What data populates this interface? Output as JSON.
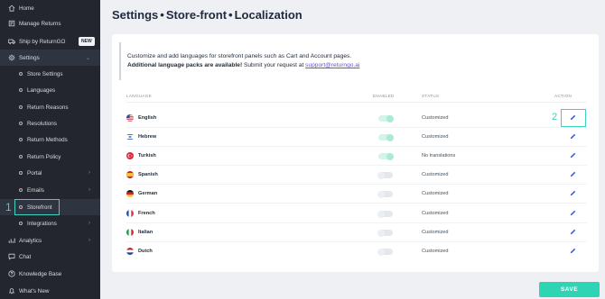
{
  "sidebar": {
    "items": [
      {
        "label": "Home",
        "icon": "home-icon"
      },
      {
        "label": "Manage Returns",
        "icon": "returns-icon"
      },
      {
        "label": "Ship by ReturnGO",
        "icon": "truck-icon",
        "badge": "NEW"
      },
      {
        "label": "Settings",
        "icon": "gear-icon"
      }
    ],
    "settings_sub": [
      "Store Settings",
      "Languages",
      "Return Reasons",
      "Resolutions",
      "Return Methods",
      "Return Policy",
      "Portal",
      "Emails",
      "Storefront",
      "Integrations"
    ],
    "bottom_items": [
      {
        "label": "Analytics",
        "icon": "chart-icon"
      },
      {
        "label": "Chat",
        "icon": "chat-icon"
      },
      {
        "label": "Knowledge Base",
        "icon": "help-icon"
      },
      {
        "label": "What's New",
        "icon": "bell-icon"
      }
    ]
  },
  "annotations": {
    "step1": "1",
    "step2": "2",
    "accent": "#3ed2c3"
  },
  "header": {
    "title_bold": "Settings",
    "sep": "•",
    "crumb1": "Store-front",
    "crumb2": "Localization"
  },
  "info": {
    "line1": "Customize and add languages for storefront panels such as Cart and Account pages.",
    "line2_bold": "Additional language packs are available!",
    "line2_text": " Submit your request at ",
    "line2_link": "support@returngo.ai"
  },
  "table": {
    "columns": {
      "language": "LANGUAGE",
      "enabled": "ENABLED",
      "status": "STATUS",
      "action": "ACTION"
    },
    "rows": [
      {
        "language": "English",
        "enabled": true,
        "status": "Customized",
        "flag": "us-flag"
      },
      {
        "language": "Hebrew",
        "enabled": true,
        "status": "Customized",
        "flag": "israel-flag"
      },
      {
        "language": "Turkish",
        "enabled": true,
        "status": "No translations",
        "flag": "turkey-flag"
      },
      {
        "language": "Spanish",
        "enabled": false,
        "status": "Customized",
        "flag": "spain-flag"
      },
      {
        "language": "German",
        "enabled": false,
        "status": "Customized",
        "flag": "germany-flag"
      },
      {
        "language": "French",
        "enabled": false,
        "status": "Customized",
        "flag": "france-flag"
      },
      {
        "language": "Italian",
        "enabled": false,
        "status": "Customized",
        "flag": "italy-flag"
      },
      {
        "language": "Dutch",
        "enabled": false,
        "status": "Customized",
        "flag": "netherlands-flag"
      }
    ]
  },
  "save_label": "SAVE",
  "colors": {
    "accent": "#2ed5b5",
    "sidebar_bg": "#23262e",
    "link": "#6c4ee0"
  }
}
